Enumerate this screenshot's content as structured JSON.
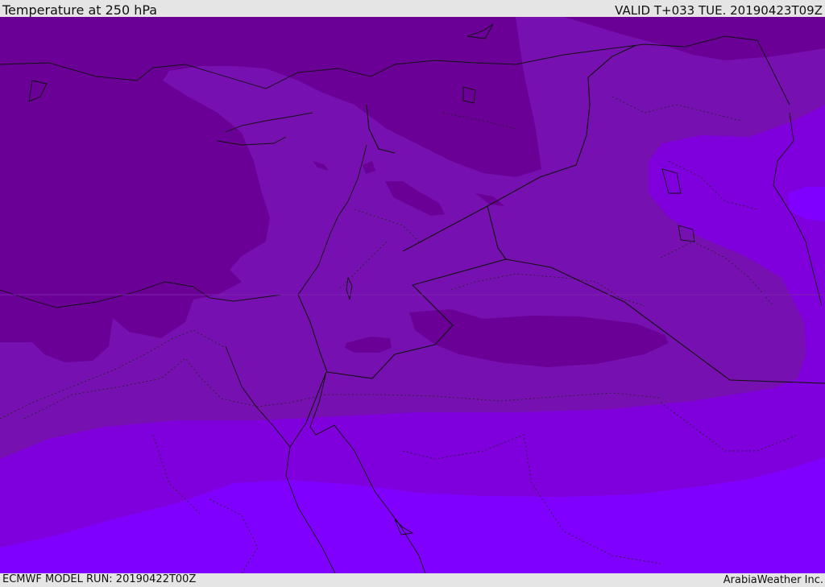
{
  "header": {
    "title": "Temperature at 250 hPa",
    "valid": "VALID T+033 TUE. 20190423T09Z"
  },
  "footer": {
    "model_run": "ECMWF MODEL RUN: 20190422T00Z",
    "credit": "ArabiaWeather Inc."
  },
  "map": {
    "variable": "Temperature at 250 hPa",
    "palette": {
      "darkest": "#6a0096",
      "dark": "#7710b0",
      "medium": "#8000dd",
      "light": "#8000ff"
    }
  }
}
